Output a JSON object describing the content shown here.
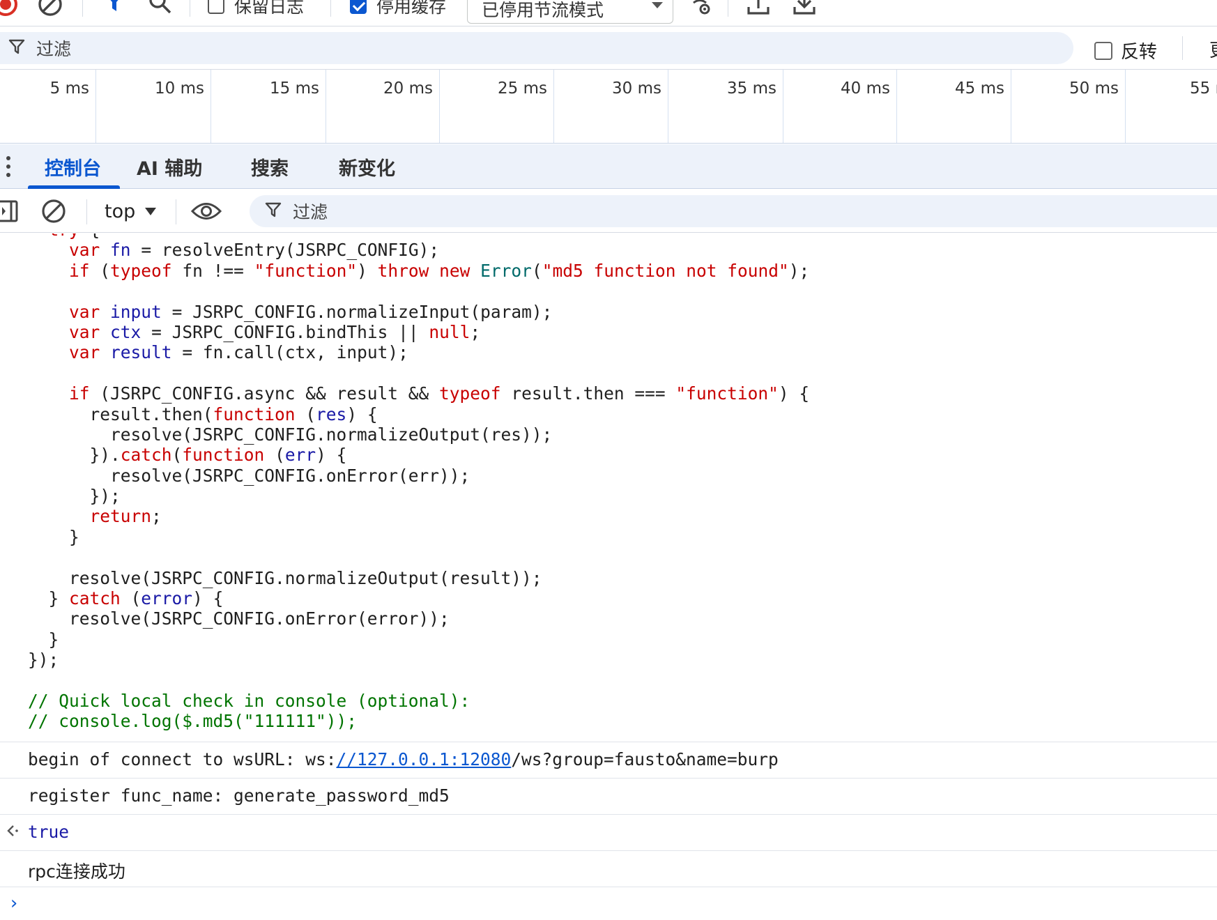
{
  "network_toolbar": {
    "preserve_log_label": "保留日志",
    "preserve_log_checked": false,
    "disable_cache_label": "停用缓存",
    "disable_cache_checked": true,
    "throttling_value": "已停用节流模式",
    "icons": [
      "record-icon",
      "clear-icon",
      "filter-icon",
      "search-icon",
      "network-conditions-icon",
      "import-har-icon",
      "export-har-icon"
    ]
  },
  "filter_bar": {
    "placeholder": "过滤",
    "invert_label": "反转",
    "invert_checked": false,
    "clipped_text": "更"
  },
  "timeline": {
    "ticks": [
      "5 ms",
      "10 ms",
      "15 ms",
      "20 ms",
      "25 ms",
      "30 ms",
      "35 ms",
      "40 ms",
      "45 ms",
      "50 ms",
      "55 ms"
    ]
  },
  "drawer": {
    "tabs": [
      {
        "label": "控制台",
        "active": true
      },
      {
        "label": "AI 辅助",
        "active": false
      },
      {
        "label": "搜索",
        "active": false
      },
      {
        "label": "新变化",
        "active": false
      }
    ]
  },
  "console_toolbar": {
    "context": "top",
    "filter_placeholder": "过滤"
  },
  "console": {
    "code_lines": [
      "  try {",
      "    var fn = resolveEntry(JSRPC_CONFIG);",
      "    if (typeof fn !== \"function\") throw new Error(\"md5 function not found\");",
      "",
      "    var input = JSRPC_CONFIG.normalizeInput(param);",
      "    var ctx = JSRPC_CONFIG.bindThis || null;",
      "    var result = fn.call(ctx, input);",
      "",
      "    if (JSRPC_CONFIG.async && result && typeof result.then === \"function\") {",
      "      result.then(function (res) {",
      "        resolve(JSRPC_CONFIG.normalizeOutput(res));",
      "      }).catch(function (err) {",
      "        resolve(JSRPC_CONFIG.onError(err));",
      "      });",
      "      return;",
      "    }",
      "",
      "    resolve(JSRPC_CONFIG.normalizeOutput(result));",
      "  } catch (error) {",
      "    resolve(JSRPC_CONFIG.onError(error));",
      "  }",
      "});",
      "",
      "// Quick local check in console (optional):",
      "// console.log($.md5(\"111111\"));"
    ],
    "log_connect_prefix": "begin of connect to wsURL: ws:",
    "log_connect_link": "//127.0.0.1:12080",
    "log_connect_suffix": "/ws?group=fausto&name=burp",
    "log_register": "register func_name: generate_password_md5",
    "return_value": "true",
    "log_success": "rpc连接成功",
    "prompt_symbol": "›"
  }
}
